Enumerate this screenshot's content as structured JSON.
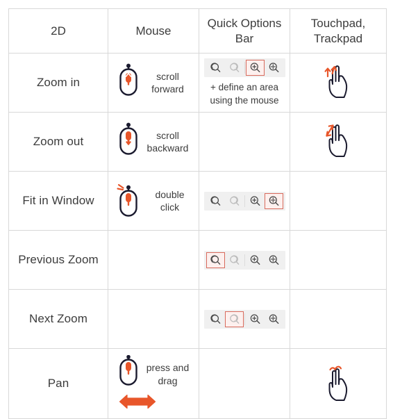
{
  "table": {
    "headers": [
      {
        "label": "2D",
        "name": "header-2d"
      },
      {
        "label": "Mouse",
        "name": "header-mouse"
      },
      {
        "label": "Quick Options Bar",
        "name": "header-quick-options-bar"
      },
      {
        "label": "Touchpad, Trackpad",
        "name": "header-touchpad-trackpad"
      }
    ],
    "rows": [
      {
        "action": "Zoom in",
        "mouse_caption": "scroll forward",
        "mouse_icon": "mouse-scroll-forward-icon",
        "qob_selected": "zoom-in",
        "qob_note": "+ define an area using the mouse",
        "touchpad_icon": "two-finger-scroll-up-icon"
      },
      {
        "action": "Zoom out",
        "mouse_caption": "scroll backward",
        "mouse_icon": "mouse-scroll-backward-icon",
        "qob_selected": "",
        "qob_note": "",
        "touchpad_icon": "two-finger-pinch-icon"
      },
      {
        "action": "Fit in Window",
        "mouse_caption": "double click",
        "mouse_icon": "mouse-double-click-icon",
        "qob_selected": "fit-in-window",
        "qob_note": "",
        "touchpad_icon": ""
      },
      {
        "action": "Previous Zoom",
        "mouse_caption": "",
        "mouse_icon": "",
        "qob_selected": "previous-zoom",
        "qob_note": "",
        "touchpad_icon": ""
      },
      {
        "action": "Next Zoom",
        "mouse_caption": "",
        "mouse_icon": "",
        "qob_selected": "next-zoom",
        "qob_note": "",
        "touchpad_icon": ""
      },
      {
        "action": "Pan",
        "mouse_caption": "press and drag",
        "mouse_icon": "mouse-press-and-drag-icon",
        "qob_selected": "",
        "qob_note": "",
        "touchpad_icon": "two-finger-swipe-icon"
      }
    ],
    "quick_options_bar": {
      "buttons": [
        {
          "id": "previous-zoom",
          "name": "previous-zoom-icon",
          "state": "enabled"
        },
        {
          "id": "next-zoom",
          "name": "next-zoom-icon",
          "state": "disabled"
        },
        {
          "id": "zoom-in",
          "name": "zoom-in-icon",
          "state": "enabled"
        },
        {
          "id": "fit-in-window",
          "name": "fit-in-window-icon",
          "state": "enabled"
        }
      ]
    }
  },
  "colors": {
    "highlight": "#d86a5c",
    "highlight_fill": "#fdf0ee",
    "accent_orange": "#e8562a",
    "toolbar_bg": "#f0f0f0",
    "icon_dark": "#1b1b2f",
    "icon_grey": "#4a4a4a",
    "icon_disabled": "#bcbcbc",
    "border": "#d8d8d8",
    "text": "#3c3c3c"
  }
}
